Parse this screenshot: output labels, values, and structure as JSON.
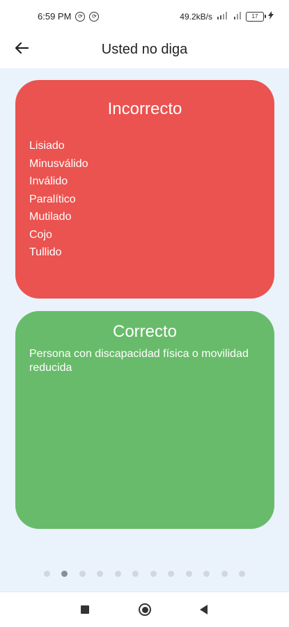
{
  "status": {
    "time": "6:59 PM",
    "left_icons": [
      "notification-icon",
      "notification-icon"
    ],
    "speed": "49.2kB/s",
    "signal": "signal-icon",
    "battery": "17"
  },
  "header": {
    "title": "Usted no diga",
    "back_icon": "arrow-left-icon"
  },
  "cards": {
    "incorrect": {
      "title": "Incorrecto",
      "color": "#ea5350",
      "items": [
        "Lisiado",
        "Minusválido",
        "Inválido",
        "Paralítico",
        "Mutilado",
        "Cojo",
        "Tullido"
      ]
    },
    "correct": {
      "title": "Correcto",
      "color": "#68bb6a",
      "text": "Persona con discapacidad física o movilidad reducida"
    }
  },
  "pager": {
    "count": 12,
    "active_index": 1
  },
  "navbar": {
    "recents": "square-icon",
    "home": "circle-icon",
    "back": "triangle-back-icon"
  }
}
